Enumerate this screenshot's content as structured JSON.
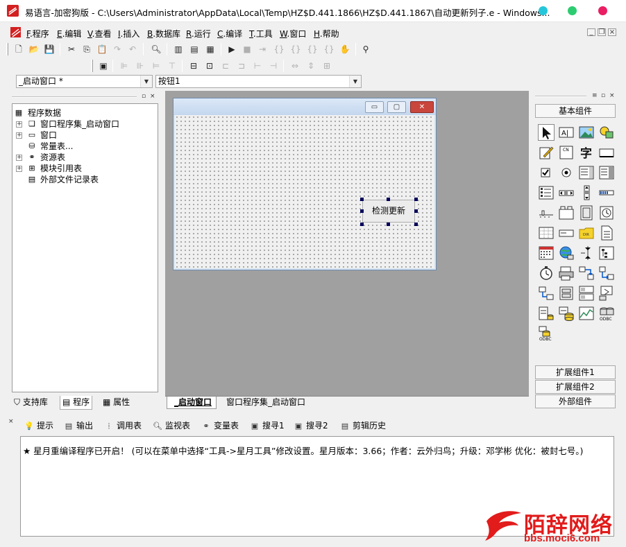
{
  "window": {
    "title": "易语言-加密狗版 - C:\\Users\\Administrator\\AppData\\Local\\Temp\\HZ$D.441.1866\\HZ$D.441.1867\\自动更新列子.e - Windows...",
    "traffic_lights": [
      "#26c6da",
      "#2ecc71",
      "#e91e63"
    ]
  },
  "menu": {
    "items": [
      {
        "key": "F",
        "label": ".程序"
      },
      {
        "key": "E",
        "label": ".编辑"
      },
      {
        "key": "V",
        "label": ".查看"
      },
      {
        "key": "I",
        "label": ".插入"
      },
      {
        "key": "B",
        "label": ".数据库"
      },
      {
        "key": "R",
        "label": ".运行"
      },
      {
        "key": "C",
        "label": ".编译"
      },
      {
        "key": "T",
        "label": ".工具"
      },
      {
        "key": "W",
        "label": ".窗口"
      },
      {
        "key": "H",
        "label": ".帮助"
      }
    ]
  },
  "selectors": {
    "window_combo": "_启动窗口 *",
    "component_combo": "按钮1"
  },
  "left_panel": {
    "tree": [
      {
        "label": "程序数据",
        "icon": "program-data-icon",
        "glyph": "▦",
        "expand": ""
      },
      {
        "label": "窗口程序集_启动窗口",
        "icon": "assembly-icon",
        "glyph": "❏",
        "expand": "+"
      },
      {
        "label": "窗口",
        "icon": "window-icon",
        "glyph": "▭",
        "expand": "+"
      },
      {
        "label": "常量表...",
        "icon": "constants-icon",
        "glyph": "⛁",
        "expand": ""
      },
      {
        "label": "资源表",
        "icon": "resources-icon",
        "glyph": "⚭",
        "expand": "+"
      },
      {
        "label": "模块引用表",
        "icon": "module-ref-icon",
        "glyph": "⊞",
        "expand": "+"
      },
      {
        "label": "外部文件记录表",
        "icon": "external-files-icon",
        "glyph": "▤",
        "expand": ""
      }
    ],
    "tabs": [
      "支持库",
      "程序",
      "属性"
    ]
  },
  "designer": {
    "button_label": "检测更新",
    "doc_tabs": [
      "_启动窗口",
      "窗口程序集_启动窗口"
    ]
  },
  "right_panel": {
    "basic_title": "基本组件",
    "ext1": "扩展组件1",
    "ext2": "扩展组件2",
    "external": "外部组件",
    "components": [
      "pointer-icon",
      "label-icon",
      "picture-box-icon",
      "shape-icon",
      "edit-icon",
      "editbox-icon",
      "text-char-icon",
      "button-icon",
      "checkbox-icon",
      "radio-icon",
      "combobox-icon",
      "listbox-icon",
      "multi-listbox-icon",
      "scrollbar-h-icon",
      "scrollbar-v-icon",
      "progress-icon",
      "slider-icon",
      "tab-icon",
      "frame-icon",
      "clock-icon",
      "grid-icon",
      "statusbar-icon",
      "folder-dir-icon",
      "file-list-icon",
      "calendar-icon",
      "network-icon",
      "spinner-icon",
      "tree-icon",
      "timer-icon",
      "printer-icon",
      "transfer-icon",
      "socket-icon",
      "client-icon",
      "server-icon",
      "panel-icon",
      "tab-control-icon",
      "db-list-icon",
      "db-icon",
      "chart-icon",
      "odbc-icon",
      "odbc-db-icon"
    ]
  },
  "output": {
    "tabs": [
      "提示",
      "输出",
      "调用表",
      "监视表",
      "变量表",
      "搜寻1",
      "搜寻2",
      "剪辑历史"
    ],
    "message": "★ 星月重编译程序已开启！ (可以在菜单中选择“工具->星月工具”修改设置。星月版本：3.66；作者：云外归鸟；升级：邓学彬 优化：被封七号。)"
  },
  "watermark": {
    "brand": "陌辞网络",
    "url": "bbs.moci6.com"
  }
}
